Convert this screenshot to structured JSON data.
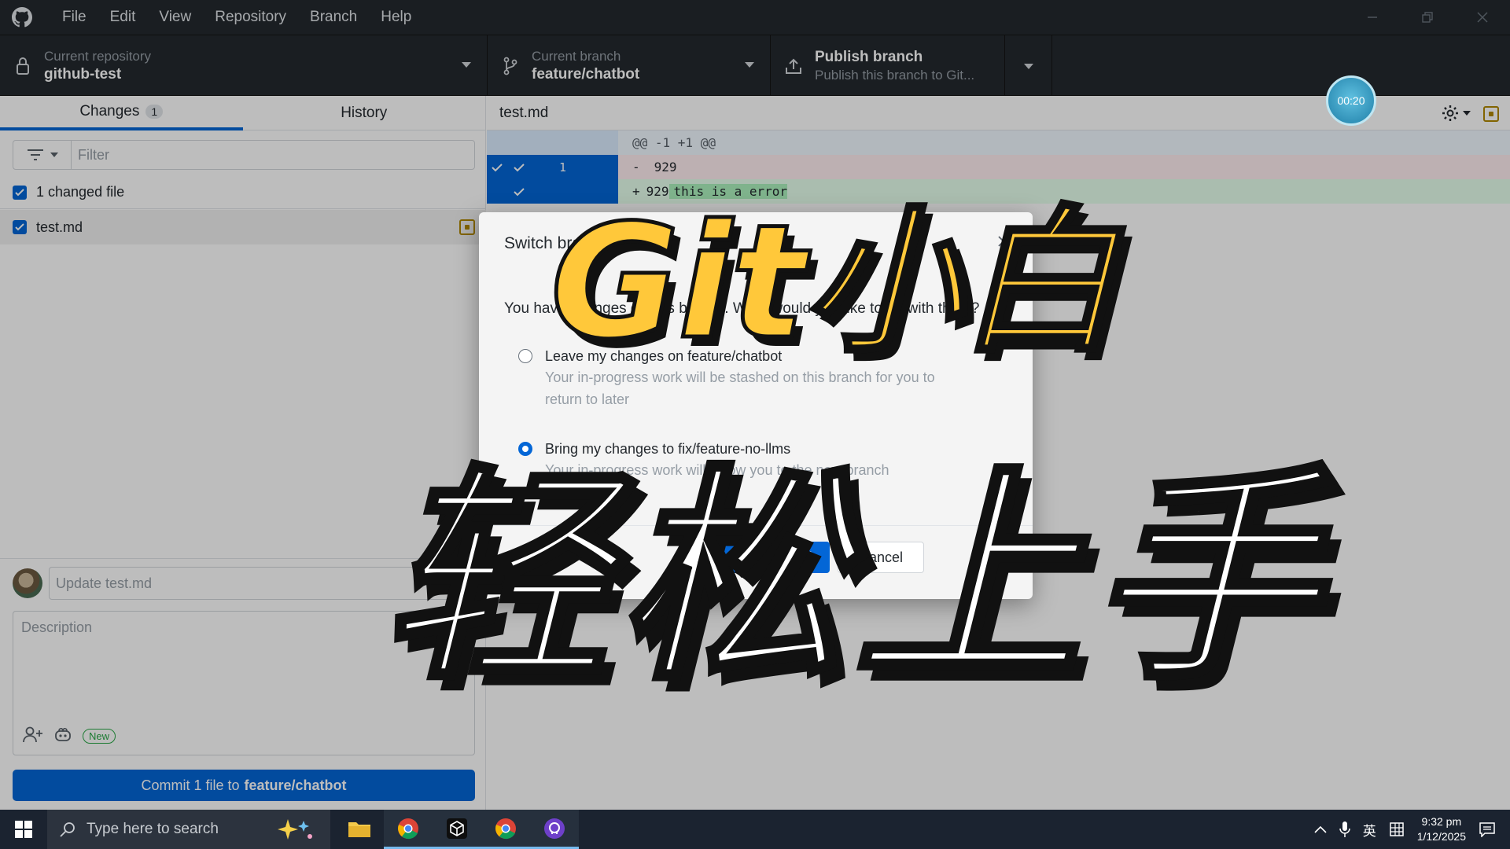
{
  "menu": [
    "File",
    "Edit",
    "View",
    "Repository",
    "Branch",
    "Help"
  ],
  "toolbar": {
    "repo_label": "Current repository",
    "repo_value": "github-test",
    "branch_label": "Current branch",
    "branch_value": "feature/chatbot",
    "publish_title": "Publish branch",
    "publish_desc": "Publish this branch to Git..."
  },
  "sidebar": {
    "tab_changes": "Changes",
    "tab_changes_count": "1",
    "tab_history": "History",
    "filter_placeholder": "Filter",
    "changed_files_label": "1 changed file",
    "file_name": "test.md"
  },
  "commit": {
    "summary_placeholder": "Update test.md",
    "description_placeholder": "Description",
    "new_badge": "New",
    "button_prefix": "Commit 1 file to",
    "button_branch": "feature/chatbot"
  },
  "diff": {
    "file_name": "test.md",
    "hunk_header": "@@ -1 +1 @@",
    "line_number": "1",
    "removed_marker": "-",
    "removed_text": "929",
    "added_marker": "+",
    "added_prefix": "929",
    "added_highlight": "this is a error"
  },
  "timer": "00:20",
  "dialog": {
    "title": "Switch branch",
    "prompt": "You have changes on this branch. What would you like to do with them?",
    "option1_title": "Leave my changes on feature/chatbot",
    "option1_desc": "Your in-progress work will be stashed on this branch for you to return to later",
    "option2_title": "Bring my changes to fix/feature-no-llms",
    "option2_desc": "Your in-progress work will follow you to the new branch",
    "switch_button": "Switch branch",
    "cancel_button": "Cancel"
  },
  "overlay": {
    "line1": "Git小白",
    "line2": "轻松上手"
  },
  "taskbar": {
    "search_placeholder": "Type here to search",
    "ime_label": "英",
    "time": "9:32 pm",
    "date": "1/12/2025"
  },
  "colors": {
    "accent": "#0366d6",
    "titlebar": "#24292e",
    "overlay_yellow": "#ffc83a",
    "added_bg": "#e6ffed",
    "removed_bg": "#ffeef0"
  }
}
